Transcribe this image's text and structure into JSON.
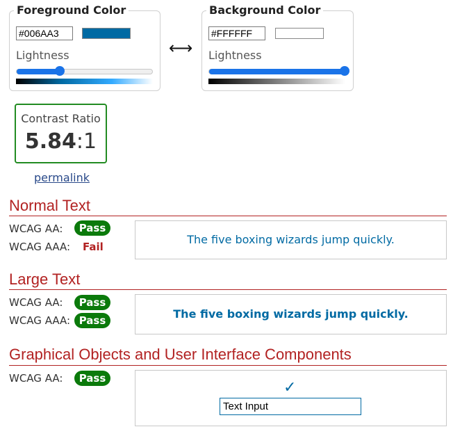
{
  "foreground": {
    "title": "Foreground Color",
    "hex": "#006AA3",
    "swatch_color": "#006AA3",
    "lightness_label": "Lightness",
    "lightness_value": 0.32
  },
  "swap_symbol": "⟷",
  "background": {
    "title": "Background Color",
    "hex": "#FFFFFF",
    "swatch_color": "#FFFFFF",
    "lightness_label": "Lightness",
    "lightness_value": 1.0
  },
  "contrast": {
    "label": "Contrast Ratio",
    "value": "5.84",
    "suffix": ":1"
  },
  "permalink": "permalink",
  "sections": {
    "normal": {
      "title": "Normal Text",
      "aa_label": "WCAG AA:",
      "aa_result": "Pass",
      "aaa_label": "WCAG AAA:",
      "aaa_result": "Fail",
      "sample": "The five boxing wizards jump quickly."
    },
    "large": {
      "title": "Large Text",
      "aa_label": "WCAG AA:",
      "aa_result": "Pass",
      "aaa_label": "WCAG AAA:",
      "aaa_result": "Pass",
      "sample": "The five boxing wizards jump quickly."
    },
    "graphical": {
      "title": "Graphical Objects and User Interface Components",
      "aa_label": "WCAG AA:",
      "aa_result": "Pass",
      "checkmark": "✓",
      "input_value": "Text Input"
    }
  },
  "colors": {
    "pass_badge": "#0B7A0B",
    "fail_text": "#B22222",
    "section_heading": "#B22222",
    "slider_accent": "#1A73E8",
    "ratio_border": "#228B22"
  }
}
